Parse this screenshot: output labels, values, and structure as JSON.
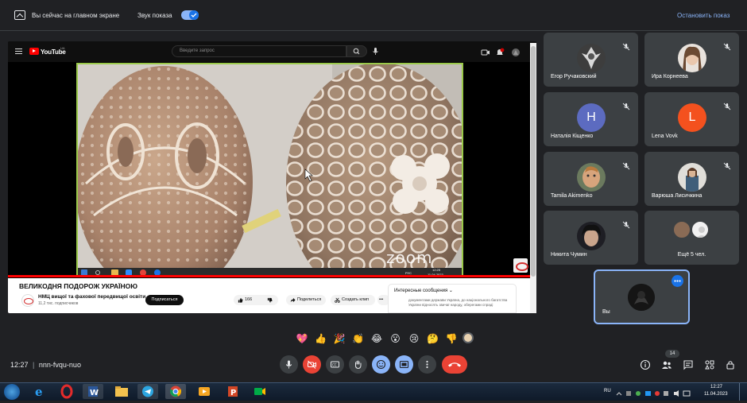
{
  "topbar": {
    "presenting_text": "Вы сейчас на главном экране",
    "sound_label": "Звук показа",
    "stop_label": "Остановить показ"
  },
  "youtube": {
    "logo_text": "YouTube",
    "region": "UA",
    "search_placeholder": "Введите запрос",
    "notif_count": "9",
    "video_title": "ВЕЛИКОДНЯ ПОДОРОЖ УКРАЇНОЮ",
    "channel_name": "НМЦ вищої та фахової передвищої освіти",
    "channel_subs": "11,2 тис. подписчиков",
    "subscribe_label": "Подписаться",
    "likes": "166",
    "share_label": "Поделиться",
    "clip_label": "Создать клип",
    "more_label": "•••",
    "chat_header": "Интересные сообщения",
    "chat_text": "документами держави Україна, до національного багатства України відносять звичаї народу, оберегами спраді",
    "zoom_watermark": "zoom",
    "zoom_taskbar_time": "12:25",
    "zoom_taskbar_date": "11.04.2023",
    "zoom_taskbar_lang": "РУС",
    "progress_fraction": 1.0
  },
  "participants": [
    {
      "name": "Егор Ручаковский",
      "avatar": "photo",
      "muted": true
    },
    {
      "name": "Ира Корнеева",
      "avatar": "photo",
      "muted": true
    },
    {
      "name": "Наталія Кіщенко",
      "avatar": "letter",
      "letter": "H",
      "color": "#5c6bc0",
      "muted": true
    },
    {
      "name": "Lena Vovk",
      "avatar": "letter",
      "letter": "L",
      "color": "#f4511e",
      "muted": true
    },
    {
      "name": "Tamila Akimenko",
      "avatar": "photo",
      "muted": true
    },
    {
      "name": "Варюша Лисичкина",
      "avatar": "photo",
      "muted": true
    },
    {
      "name": "Никита Чумин",
      "avatar": "photo",
      "muted": true
    },
    {
      "name": "Ещё 5 чел.",
      "avatar": "group",
      "muted": false
    }
  ],
  "self_tile": {
    "name": "Вы",
    "more_icon": "three-dots-icon"
  },
  "reactions": [
    "💖",
    "👍",
    "🎉",
    "👏",
    "😂",
    "😮",
    "😢",
    "🤔",
    "👎"
  ],
  "bottom": {
    "time": "12:27",
    "meeting_code": "nnn-fvqu-nuo",
    "participants_count": "14"
  },
  "taskbar": {
    "lang": "RU",
    "time": "12:27",
    "date": "11.04.2023"
  },
  "colors": {
    "accent": "#8ab4f8",
    "end_call": "#ea4335",
    "tile_bg": "#3c4043",
    "bg": "#202124"
  }
}
